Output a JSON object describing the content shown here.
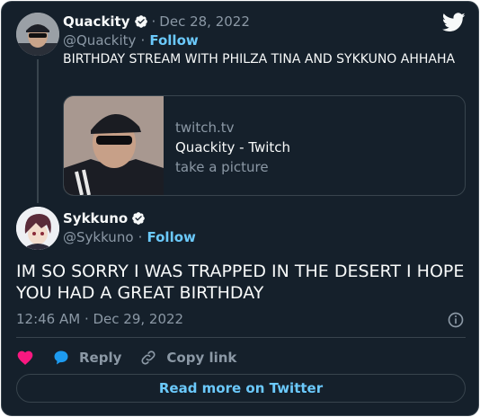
{
  "colors": {
    "background": "#15202b",
    "border": "#38444d",
    "accent": "#6bc9fb",
    "muted": "#8b98a5",
    "heart": "#f91880",
    "verified": "#f7f9f9"
  },
  "parent_tweet": {
    "name": "Quackity",
    "date": "Dec 28, 2022",
    "handle": "@Quackity",
    "follow_label": "Follow",
    "text": "BIRTHDAY STREAM WITH PHILZA TINA AND SYKKUNO AHHAHA",
    "link_card": {
      "domain": "twitch.tv",
      "title": "Quackity - Twitch",
      "description": "take a picture"
    }
  },
  "reply_tweet": {
    "name": "Sykkuno",
    "handle": "@Sykkuno",
    "follow_label": "Follow",
    "text": "IM SO SORRY I WAS TRAPPED IN THE DESERT I HOPE YOU HAD A GREAT BIRTHDAY",
    "timestamp": "12:46 AM · Dec 29, 2022"
  },
  "actions": {
    "like_icon": "heart-icon",
    "reply_label": "Reply",
    "copy_link_label": "Copy link"
  },
  "read_more_label": "Read more on Twitter",
  "separator": "·"
}
